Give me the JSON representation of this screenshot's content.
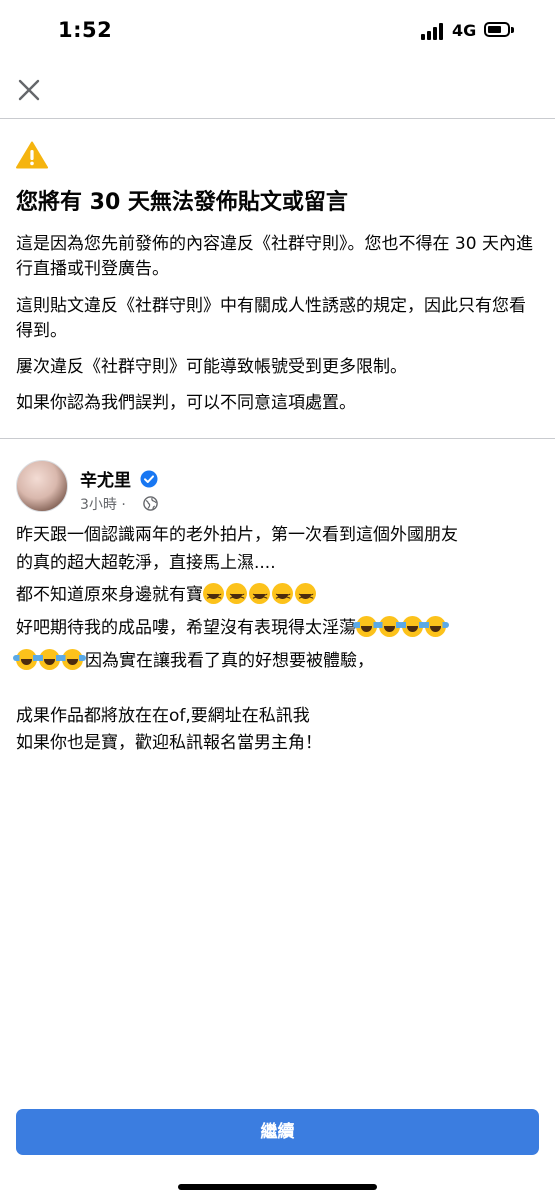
{
  "status_bar": {
    "time": "1:52",
    "network": "4G",
    "signal_icon": "cellular-signal-icon",
    "battery_icon": "battery-icon"
  },
  "header": {
    "close_icon": "close-icon"
  },
  "warning": {
    "icon": "warning-triangle-icon",
    "icon_color": "#f5b40f",
    "title": "您將有 30 天無法發佈貼文或留言",
    "paragraphs": [
      "這是因為您先前發佈的內容違反《社群守則》。您也不得在 30 天內進行直播或刊登廣告。",
      "這則貼文違反《社群守則》中有關成人性誘惑的規定，因此只有您看得到。",
      "屢次違反《社群守則》可能導致帳號受到更多限制。",
      "如果你認為我們誤判，可以不同意這項處置。"
    ]
  },
  "post": {
    "author": "辛尤里",
    "verified_icon": "verified-badge-icon",
    "time": "3小時",
    "separator": "·",
    "audience_icon": "globe-icon",
    "lines": {
      "l1": "昨天跟一個認識兩年的老外拍片，第一次看到這個外國朋友",
      "l2": "的真的超大超乾淨，直接馬上濕....",
      "l3": "都不知道原來身邊就有寶",
      "l4": "好吧期待我的成品嘍，希望沒有表現得太淫蕩",
      "l5": "因為實在讓我看了真的好想要被體驗，",
      "l6": "成果作品都將放在在of,要網址在私訊我",
      "l7": "如果你也是寶，歡迎私訊報名當男主角！"
    },
    "emoji": {
      "grin": "grinning-squinting-face-emoji",
      "tears": "face-with-tears-of-joy-emoji"
    }
  },
  "footer": {
    "continue_label": "繼續",
    "accent_color": "#3b7de0"
  }
}
